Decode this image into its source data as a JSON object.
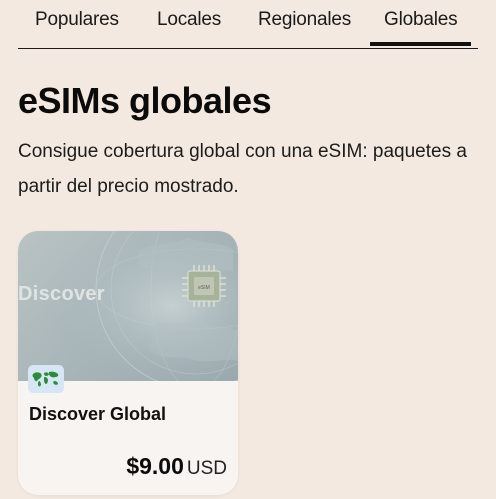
{
  "tabs": [
    {
      "label": "Populares",
      "active": false
    },
    {
      "label": "Locales",
      "active": false
    },
    {
      "label": "Regionales",
      "active": false
    },
    {
      "label": "Globales",
      "active": true
    }
  ],
  "heading": "eSIMs globales",
  "subtitle": "Consigue cobertura global con una eSIM: paquetes a partir del precio mostrado.",
  "card": {
    "image_brand_text": "Discover",
    "chip_text": "eSIM",
    "flag_icon": "world-map-icon",
    "name": "Discover Global",
    "price": "$9.00",
    "currency": "USD"
  },
  "colors": {
    "background": "#f3e9e0",
    "card_background": "#f8f4f1",
    "text": "#111111",
    "flag_badge": "#d6e6f4",
    "map_green": "#2e8b3d"
  }
}
